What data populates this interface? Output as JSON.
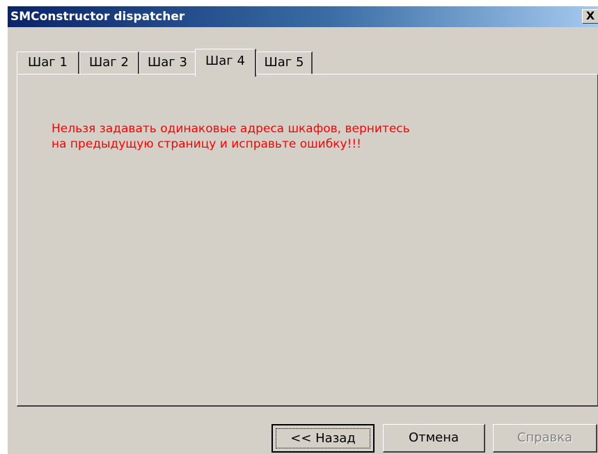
{
  "window": {
    "title": "SMConstructor dispatcher",
    "close_glyph": "X"
  },
  "tabs": [
    {
      "label": "Шаг 1",
      "active": false
    },
    {
      "label": "Шаг 2",
      "active": false
    },
    {
      "label": "Шаг 3",
      "active": false
    },
    {
      "label": "Шаг 4",
      "active": true
    },
    {
      "label": "Шаг 5",
      "active": false
    }
  ],
  "panel": {
    "error_line1": "Нельзя задавать одинаковые адреса шкафов, вернитесь",
    "error_line2": "на предыдущую страницу и исправьте ошибку!!!"
  },
  "buttons": {
    "back_label": "<< Назад",
    "cancel_label": "Отмена",
    "help_label": "Справка"
  },
  "colors": {
    "error_text": "#ff0000",
    "face": "#d4d0c8",
    "title_start": "#0a246a",
    "title_end": "#a6caf0"
  }
}
